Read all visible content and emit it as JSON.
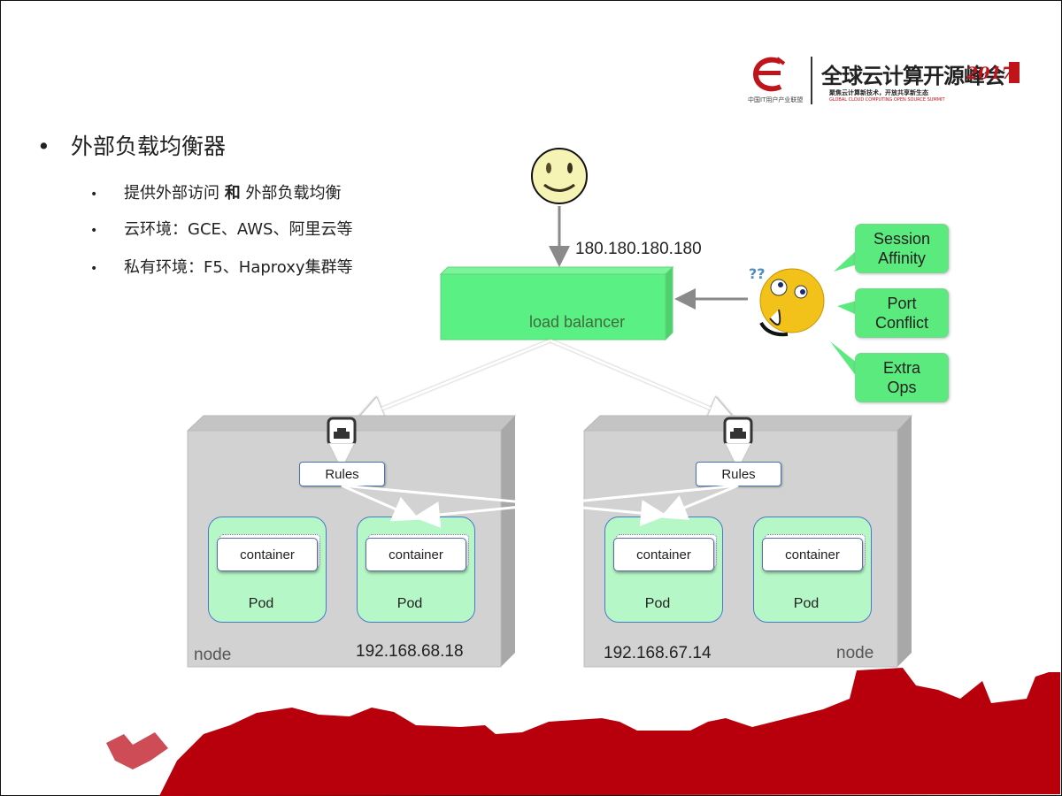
{
  "logo": {
    "org_caption": "中国IT用户产业联盟",
    "title": "全球云计算开源峰会",
    "year": "2017",
    "subtitle_cn": "聚焦云计算新技术，开放共享新生态",
    "subtitle_en": "GLOBAL CLOUD COMPUTING OPEN SOURCE SUMMIT"
  },
  "slide": {
    "heading": "外部负载均衡器",
    "bullets": [
      {
        "pre": "提供外部访问 ",
        "bold": "和",
        "post": " 外部负载均衡"
      },
      {
        "pre": "云环境：GCE、AWS、阿里云等",
        "bold": "",
        "post": ""
      },
      {
        "pre": "私有环境：F5、Haproxy集群等",
        "bold": "",
        "post": ""
      }
    ]
  },
  "diagram": {
    "external_ip": "180.180.180.180",
    "load_balancer_label": "load balancer",
    "concerns": [
      {
        "line1": "Session",
        "line2": "Affinity"
      },
      {
        "line1": "Port",
        "line2": "Conflict"
      },
      {
        "line1": "Extra",
        "line2": "Ops"
      }
    ],
    "nodes": [
      {
        "label": "node",
        "ip": "192.168.68.18",
        "rules_label": "Rules",
        "pods": [
          {
            "container": "container",
            "label": "Pod"
          },
          {
            "container": "container",
            "label": "Pod"
          }
        ]
      },
      {
        "label": "node",
        "ip": "192.168.67.14",
        "rules_label": "Rules",
        "pods": [
          {
            "container": "container",
            "label": "Pod"
          },
          {
            "container": "container",
            "label": "Pod"
          }
        ]
      }
    ],
    "colors": {
      "lb_green": "#5bf083",
      "bubble_green": "#5bea7d",
      "pod_green": "#b6f7c7",
      "node_gray": "#d2d2d2",
      "brand_red": "#b8000d"
    }
  }
}
